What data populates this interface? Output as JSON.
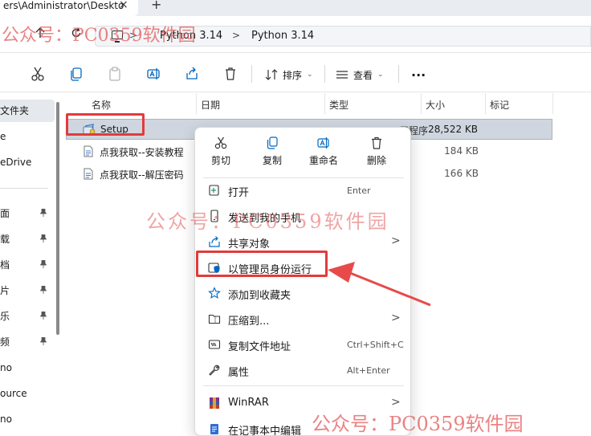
{
  "window": {
    "tab_title": "ers\\Administrator\\Deskto",
    "tab_close": "×",
    "new_tab": "+"
  },
  "address": {
    "crumbs": [
      "Python 3.14",
      "Python 3.14"
    ],
    "separator": ">"
  },
  "toolbar": {
    "sort_label": "排序",
    "view_label": "查看",
    "more": "..."
  },
  "sidebar": {
    "items": [
      "文件夹",
      "e",
      "eDrive",
      "面",
      "载",
      "档",
      "片",
      "乐",
      "频",
      "no",
      "ource",
      "no"
    ]
  },
  "columns": {
    "name": "名称",
    "date": "日期",
    "type": "类型",
    "size": "大小",
    "tags": "标记"
  },
  "files": [
    {
      "name": "Setup",
      "size": "28,522 KB",
      "type_fragment": "用程序"
    },
    {
      "name": "点我获取--安装教程",
      "size": "184 KB",
      "type_fragment": ""
    },
    {
      "name": "点我获取--解压密码",
      "size": "166 KB",
      "type_fragment": ""
    }
  ],
  "context_menu": {
    "top_actions": [
      {
        "label": "剪切",
        "icon": "scissors-icon"
      },
      {
        "label": "复制",
        "icon": "copy-icon"
      },
      {
        "label": "重命名",
        "icon": "rename-icon"
      },
      {
        "label": "删除",
        "icon": "trash-icon"
      }
    ],
    "items": [
      {
        "label": "打开",
        "shortcut": "Enter"
      },
      {
        "label": "发送到我的手机",
        "shortcut": ""
      },
      {
        "label": "共享对象",
        "shortcut": ""
      },
      {
        "label": "以管理员身份运行",
        "shortcut": ""
      },
      {
        "label": "添加到收藏夹",
        "shortcut": ""
      },
      {
        "label": "压缩到...",
        "shortcut": ""
      },
      {
        "label": "复制文件地址",
        "shortcut": "Ctrl+Shift+C"
      },
      {
        "label": "属性",
        "shortcut": "Alt+Enter"
      },
      {
        "label": "WinRAR",
        "shortcut": ""
      },
      {
        "label": "在记事本中编辑",
        "shortcut": ""
      }
    ],
    "submenu_arrow": ">"
  },
  "watermarks": {
    "top": "公众号：PC0359软件园",
    "middle": "公众号：PC0359软件园",
    "bottom": "公众号：PC0359软件园"
  },
  "colors": {
    "highlight": "#e23b3b",
    "accent": "#0067c0"
  }
}
